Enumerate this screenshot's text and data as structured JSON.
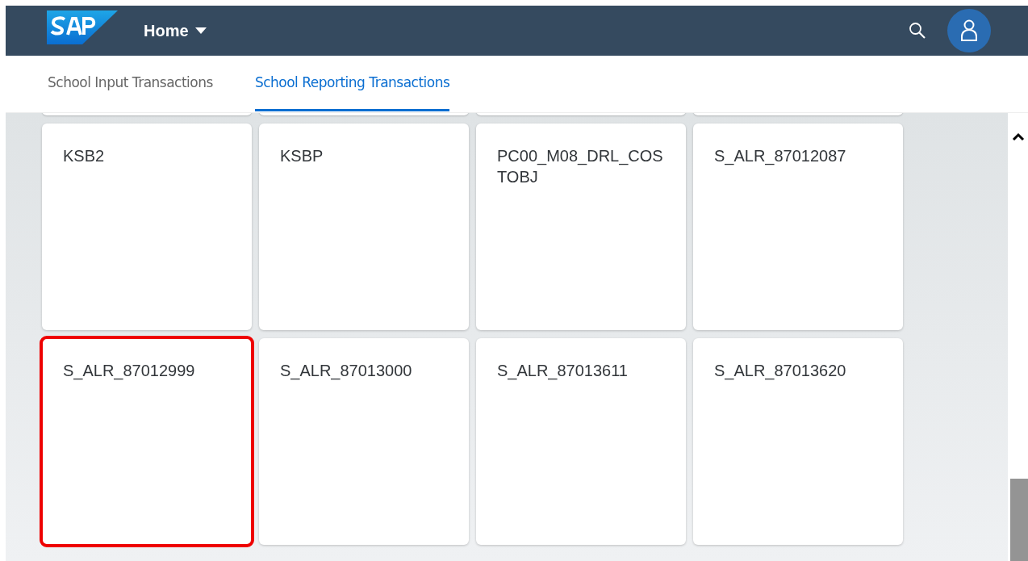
{
  "header": {
    "title": "Home"
  },
  "tabs": [
    {
      "label": "School Input Transactions",
      "selected": false
    },
    {
      "label": "School Reporting Transactions",
      "selected": true
    }
  ],
  "tiles": [
    {
      "title": "KSB2",
      "highlighted": false
    },
    {
      "title": "KSBP",
      "highlighted": false
    },
    {
      "title": "PC00_M08_DRL_COSTOBJ",
      "highlighted": false
    },
    {
      "title": "S_ALR_87012087",
      "highlighted": false
    },
    {
      "title": "S_ALR_87012999",
      "highlighted": true
    },
    {
      "title": "S_ALR_87013000",
      "highlighted": false
    },
    {
      "title": "S_ALR_87013611",
      "highlighted": false
    },
    {
      "title": "S_ALR_87013620",
      "highlighted": false
    }
  ]
}
